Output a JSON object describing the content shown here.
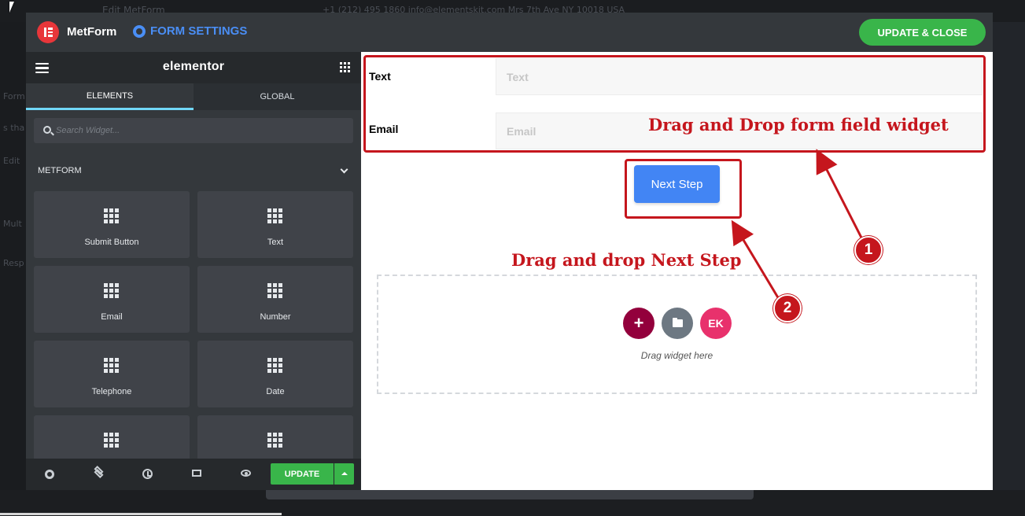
{
  "background": {
    "page_title": "Edit MetForm",
    "topline": "+1 (212) 495 1860  info@elementskit.com  Mrs 7th Ave NY 10018 USA",
    "left_labels": [
      "Form",
      "s tha",
      "Edit",
      "Mult",
      "Resp"
    ]
  },
  "header": {
    "brand": "MetForm",
    "settings_label": "FORM SETTINGS",
    "update_close_label": "UPDATE & CLOSE",
    "colors": {
      "header_bg": "#34383c",
      "accent_green": "#39b54a",
      "settings_blue": "#4a8ef5",
      "logo_red": "#e8363a"
    }
  },
  "panel": {
    "logo": "elementor",
    "tabs": [
      {
        "label": "ELEMENTS",
        "active": true
      },
      {
        "label": "GLOBAL",
        "active": false
      }
    ],
    "search": {
      "placeholder": "Search Widget...",
      "value": ""
    },
    "section_title": "METFORM",
    "widgets": [
      {
        "label": "Submit Button"
      },
      {
        "label": "Text"
      },
      {
        "label": "Email"
      },
      {
        "label": "Number"
      },
      {
        "label": "Telephone"
      },
      {
        "label": "Date"
      },
      {
        "label": ""
      },
      {
        "label": ""
      }
    ],
    "footer": {
      "icons": [
        "settings-icon",
        "layers-icon",
        "history-icon",
        "responsive-icon",
        "preview-icon"
      ],
      "update_label": "UPDATE"
    }
  },
  "canvas": {
    "fields": [
      {
        "label": "Text",
        "placeholder": "Text"
      },
      {
        "label": "Email",
        "placeholder": "Email"
      }
    ],
    "next_button_label": "Next Step",
    "dropzone_text": "Drag widget here"
  },
  "annotations": {
    "form_field_text": "Drag and Drop form field widget",
    "next_step_text": "Drag and drop Next Step",
    "markers": [
      "1",
      "2"
    ],
    "color": "#c5161d"
  }
}
